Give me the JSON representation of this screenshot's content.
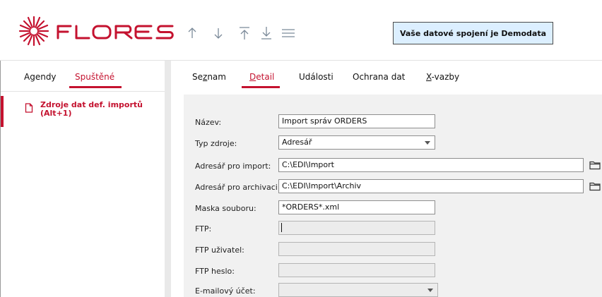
{
  "header": {
    "brand": "FLORES",
    "connection_text": "Vaše datové spojení je Demodata",
    "toolbar_icons": [
      "arrow-up-icon",
      "arrow-down-icon",
      "move-to-top-icon",
      "move-to-bottom-icon",
      "menu-icon"
    ]
  },
  "left": {
    "tabs": [
      {
        "label": "Agendy",
        "active": false
      },
      {
        "label": "Spuštěné",
        "active": true
      }
    ],
    "items": [
      {
        "label": "Zdroje dat def. importů (Alt+1)"
      }
    ]
  },
  "right": {
    "tabs": [
      {
        "label": "Seznam",
        "underline_char": "z",
        "active": false
      },
      {
        "label": "Detail",
        "underline_char": "D",
        "active": true
      },
      {
        "label": "Události",
        "active": false
      },
      {
        "label": "Ochrana dat",
        "active": false
      },
      {
        "label": "X-vazby",
        "underline_char": "X",
        "active": false
      }
    ]
  },
  "form": {
    "nazev": {
      "label": "Název:",
      "value": "Import správ ORDERS"
    },
    "typ_zdroje": {
      "label": "Typ zdroje:",
      "value": "Adresář"
    },
    "adresar_import": {
      "label": "Adresář pro import:",
      "value": "C:\\EDI\\Import"
    },
    "adresar_archiv": {
      "label": "Adresář pro archivaci:",
      "value": "C:\\EDI\\Import\\Archiv"
    },
    "maska": {
      "label": "Maska souboru:",
      "value": "*ORDERS*.xml"
    },
    "ftp": {
      "label": "FTP:",
      "value": ""
    },
    "ftp_user": {
      "label": "FTP uživatel:",
      "value": ""
    },
    "ftp_heslo": {
      "label": "FTP heslo:",
      "value": ""
    },
    "email_ucet": {
      "label": "E-mailový účet:",
      "value": ""
    }
  },
  "colors": {
    "accent": "#c4122f",
    "connection_bg": "#dcefff",
    "form_bg": "#f1f1f1"
  }
}
